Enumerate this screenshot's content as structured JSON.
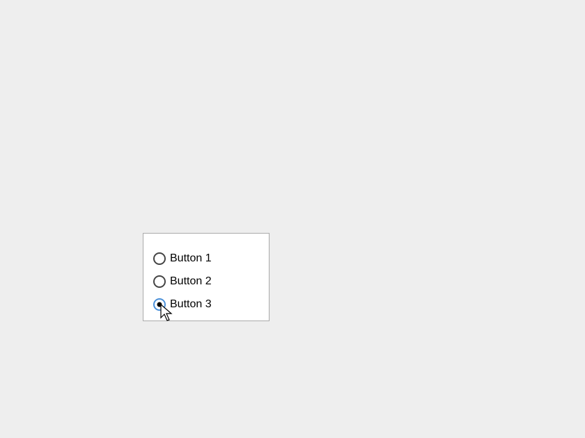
{
  "radios": {
    "items": [
      {
        "label": "Button 1",
        "selected": false,
        "focused": false
      },
      {
        "label": "Button 2",
        "selected": false,
        "focused": false
      },
      {
        "label": "Button 3",
        "selected": true,
        "focused": true
      }
    ]
  },
  "icons": {
    "radio": "radio-icon",
    "cursor": "cursor-icon"
  }
}
